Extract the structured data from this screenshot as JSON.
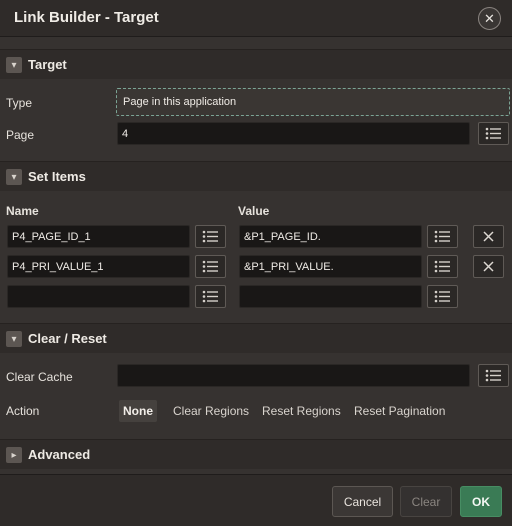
{
  "dialog": {
    "title": "Link Builder - Target",
    "close_icon": "close-icon"
  },
  "target_section": {
    "title": "Target",
    "type_label": "Type",
    "type_value": "Page in this application",
    "page_label": "Page",
    "page_value": "4"
  },
  "set_items_section": {
    "title": "Set Items",
    "name_header": "Name",
    "value_header": "Value",
    "rows": [
      {
        "name": "P4_PAGE_ID_1",
        "value": "&P1_PAGE_ID."
      },
      {
        "name": "P4_PRI_VALUE_1",
        "value": "&P1_PRI_VALUE."
      },
      {
        "name": "",
        "value": ""
      }
    ]
  },
  "clear_reset_section": {
    "title": "Clear / Reset",
    "clear_cache_label": "Clear Cache",
    "clear_cache_value": "",
    "action_label": "Action",
    "actions": [
      "None",
      "Clear Regions",
      "Reset Regions",
      "Reset Pagination"
    ],
    "selected_action": "None"
  },
  "advanced_section": {
    "title": "Advanced"
  },
  "footer": {
    "cancel_label": "Cancel",
    "clear_label": "Clear",
    "ok_label": "OK"
  },
  "colors": {
    "background": "#363230",
    "header": "#2f2b29",
    "input": "#191716",
    "ok_button": "#3a7b55"
  }
}
